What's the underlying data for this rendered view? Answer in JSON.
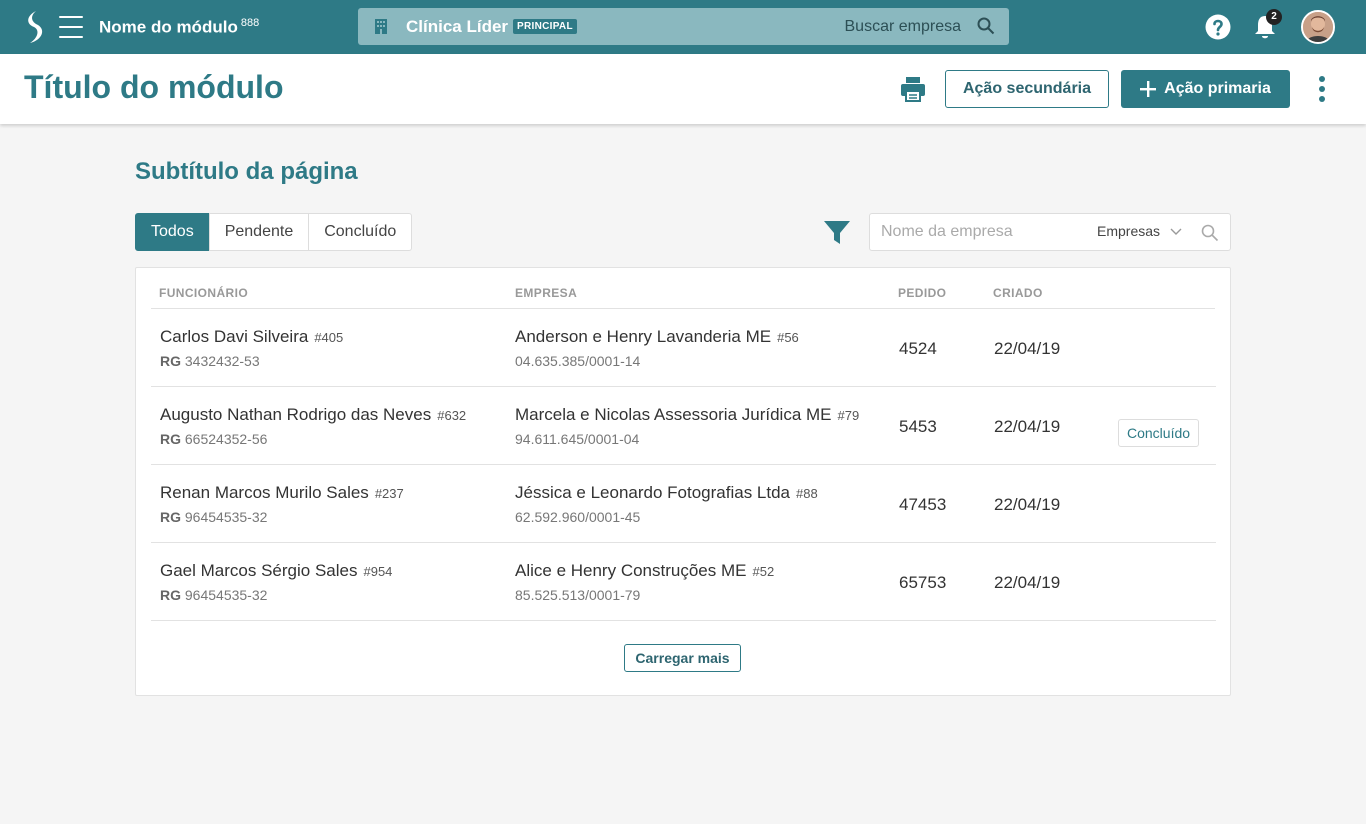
{
  "colors": {
    "primary": "#2e7a86",
    "search_bg": "#8ab8bf",
    "page_bg": "#f5f5f5"
  },
  "topbar": {
    "module_name": "Nome do módulo",
    "module_badge": "888",
    "company": {
      "name": "Clínica Líder",
      "tag": "PRINCIPAL",
      "search_label": "Buscar empresa",
      "icon": "building-icon"
    },
    "notifications_count": "2",
    "icons": [
      "logo-icon",
      "menu-icon",
      "search-icon",
      "help-icon",
      "bell-icon",
      "avatar"
    ]
  },
  "header": {
    "title": "Título do módulo",
    "secondary_action": "Ação secundária",
    "primary_action": "Ação primaria",
    "icons": [
      "print-icon",
      "plus-icon",
      "more-vertical-icon"
    ]
  },
  "content": {
    "subtitle": "Subtítulo da página",
    "tabs": [
      {
        "label": "Todos",
        "active": true
      },
      {
        "label": "Pendente",
        "active": false
      },
      {
        "label": "Concluído",
        "active": false
      }
    ],
    "filter": {
      "placeholder": "Nome da empresa",
      "select_value": "Empresas",
      "icons": [
        "filter-icon",
        "chevron-down-icon",
        "search-icon"
      ]
    }
  },
  "table": {
    "columns": [
      "FUNCIONÁRIO",
      "EMPRESA",
      "PEDIDO",
      "CRIADO"
    ],
    "rows": [
      {
        "name": "Carlos Davi Silveira",
        "id": "#405",
        "rg_label": "RG",
        "rg": "3432432-53",
        "company": "Anderson e Henry Lavanderia ME",
        "company_id": "#56",
        "cnpj": "04.635.385/0001-14",
        "pedido": "4524",
        "criado": "22/04/19",
        "status": ""
      },
      {
        "name": "Augusto Nathan Rodrigo das Neves",
        "id": "#632",
        "rg_label": "RG",
        "rg": "66524352-56",
        "company": "Marcela e Nicolas Assessoria Jurídica ME",
        "company_id": "#79",
        "cnpj": "94.611.645/0001-04",
        "pedido": "5453",
        "criado": "22/04/19",
        "status": "Concluído"
      },
      {
        "name": "Renan Marcos Murilo Sales",
        "id": "#237",
        "rg_label": "RG",
        "rg": "96454535-32",
        "company": "Jéssica e Leonardo Fotografias Ltda",
        "company_id": "#88",
        "cnpj": "62.592.960/0001-45",
        "pedido": "47453",
        "criado": "22/04/19",
        "status": ""
      },
      {
        "name": "Gael Marcos Sérgio Sales",
        "id": "#954",
        "rg_label": "RG",
        "rg": "96454535-32",
        "company": "Alice e Henry Construções ME",
        "company_id": "#52",
        "cnpj": "85.525.513/0001-79",
        "pedido": "65753",
        "criado": "22/04/19",
        "status": ""
      }
    ],
    "load_more": "Carregar mais"
  }
}
